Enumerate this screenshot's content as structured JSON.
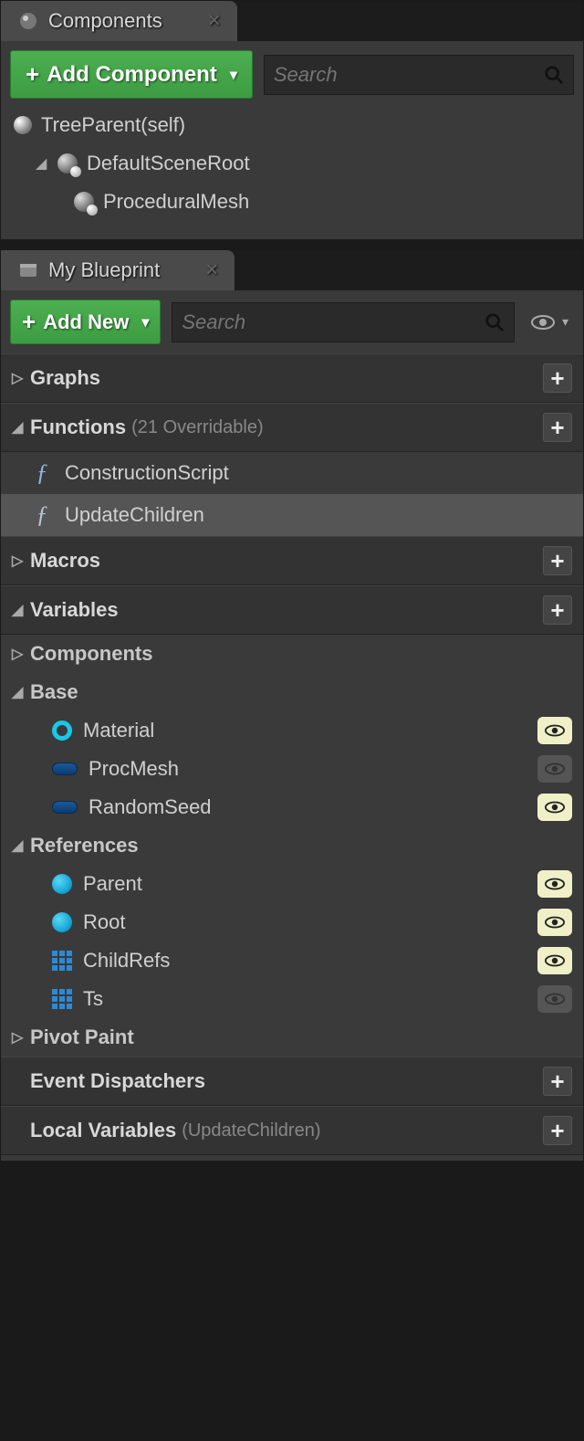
{
  "components": {
    "tab_title": "Components",
    "add_button": "Add Component",
    "search_placeholder": "Search",
    "tree": {
      "root": "TreeParent(self)",
      "scene_root": "DefaultSceneRoot",
      "child1": "ProceduralMesh"
    }
  },
  "blueprint": {
    "tab_title": "My Blueprint",
    "add_button": "Add New",
    "search_placeholder": "Search",
    "sections": {
      "graphs": "Graphs",
      "functions": "Functions",
      "functions_sub": "(21 Overridable)",
      "macros": "Macros",
      "variables": "Variables",
      "event_dispatchers": "Event Dispatchers",
      "local_variables": "Local Variables",
      "local_variables_sub": "(UpdateChildren)"
    },
    "functions": {
      "construction": "ConstructionScript",
      "update_children": "UpdateChildren"
    },
    "var_groups": {
      "components": "Components",
      "base": "Base",
      "references": "References",
      "pivot_paint": "Pivot Paint"
    },
    "vars": {
      "material": "Material",
      "procmesh": "ProcMesh",
      "randomseed": "RandomSeed",
      "parent": "Parent",
      "root": "Root",
      "childrefs": "ChildRefs",
      "ts": "Ts"
    }
  }
}
